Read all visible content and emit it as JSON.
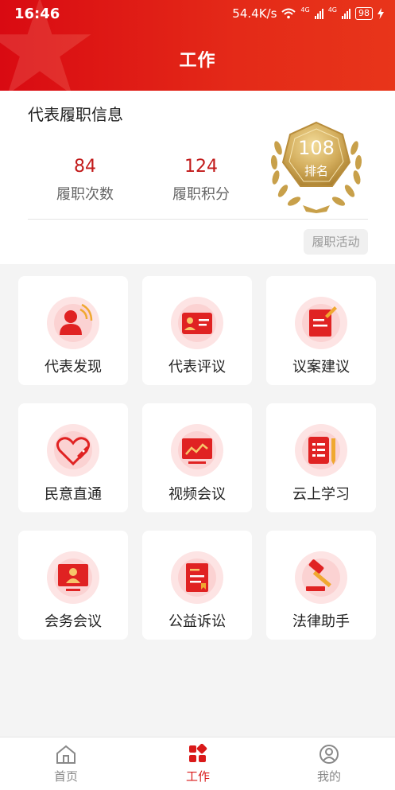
{
  "status_bar": {
    "time": "16:46",
    "network_speed": "54.4K/s",
    "signal1_label": "4G",
    "signal2_label": "4G",
    "battery": "98"
  },
  "header": {
    "title": "工作"
  },
  "info_card": {
    "title": "代表履职信息",
    "stats": [
      {
        "value": "84",
        "label": "履职次数"
      },
      {
        "value": "124",
        "label": "履职积分"
      }
    ],
    "rank": {
      "value": "108",
      "label": "排名"
    },
    "activity_button": "履职活动"
  },
  "grid": [
    {
      "label": "代表发现",
      "icon": "person-broadcast-icon"
    },
    {
      "label": "代表评议",
      "icon": "id-card-icon"
    },
    {
      "label": "议案建议",
      "icon": "document-edit-icon"
    },
    {
      "label": "民意直通",
      "icon": "heart-tag-icon"
    },
    {
      "label": "视频会议",
      "icon": "monitor-chart-icon"
    },
    {
      "label": "云上学习",
      "icon": "notebook-pen-icon"
    },
    {
      "label": "会务会议",
      "icon": "presenter-screen-icon"
    },
    {
      "label": "公益诉讼",
      "icon": "law-book-icon"
    },
    {
      "label": "法律助手",
      "icon": "gavel-icon"
    }
  ],
  "bottom_nav": [
    {
      "label": "首页",
      "icon": "home-icon",
      "active": false
    },
    {
      "label": "工作",
      "icon": "work-grid-icon",
      "active": true
    },
    {
      "label": "我的",
      "icon": "user-icon",
      "active": false
    }
  ],
  "colors": {
    "brand_red": "#d91a1a",
    "header_red": "#e42a18",
    "gold": "#c9a24a"
  }
}
